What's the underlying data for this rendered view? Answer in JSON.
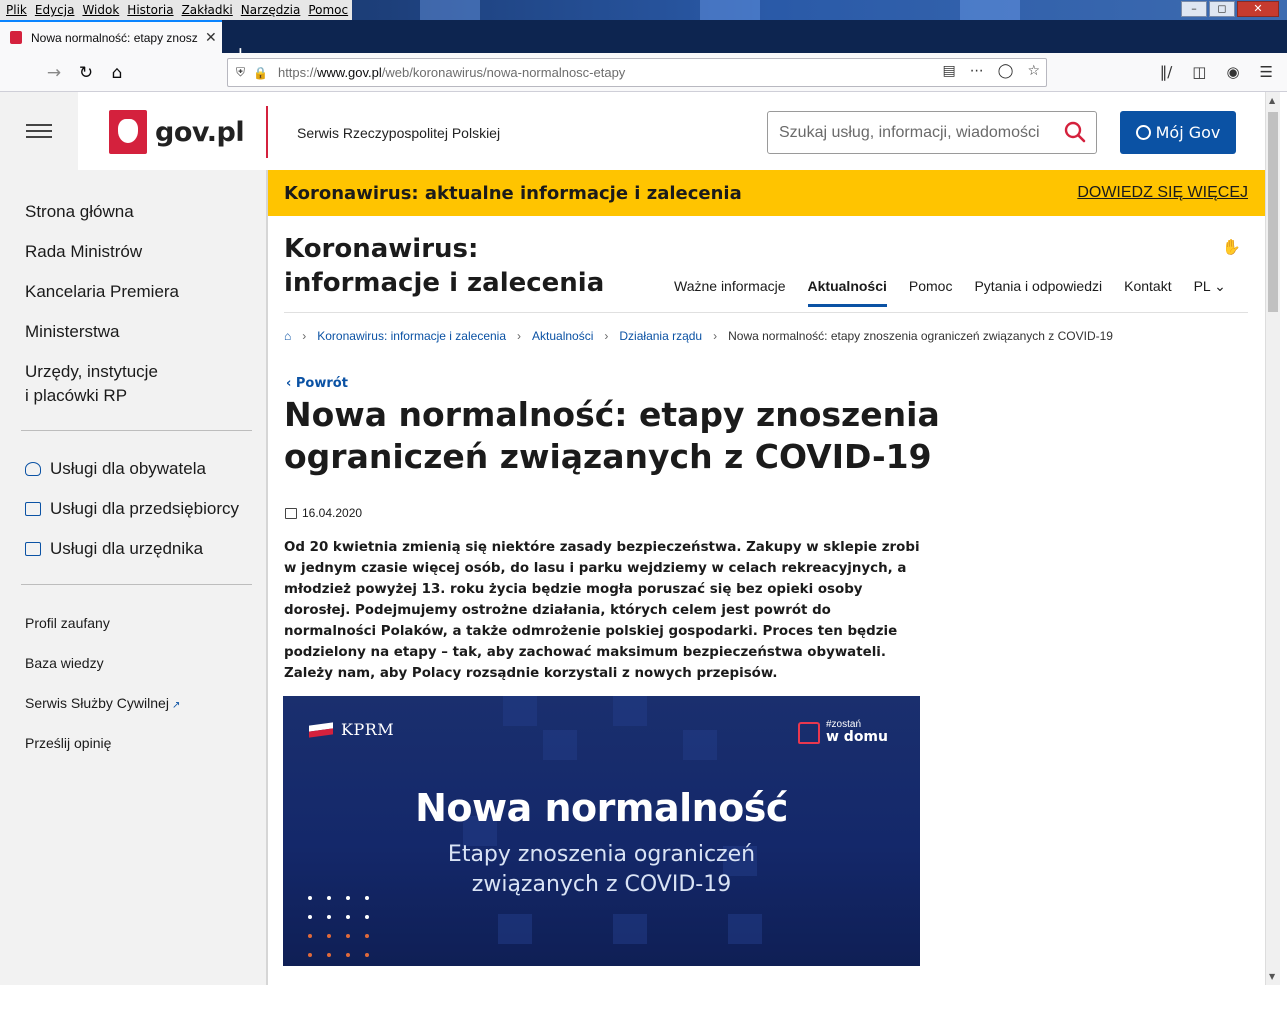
{
  "browser": {
    "menu": [
      "Plik",
      "Edycja",
      "Widok",
      "Historia",
      "Zakładki",
      "Narzędzia",
      "Pomoc"
    ],
    "tab_title": "Nowa normalność: etapy znosz",
    "url_prefix": "https://",
    "url_host": "www.gov.pl",
    "url_path": "/web/koronawirus/nowa-normalnosc-etapy"
  },
  "header": {
    "logo_text": "gov.pl",
    "tagline": "Serwis Rzeczypospolitej Polskiej",
    "search_placeholder": "Szukaj usług, informacji, wiadomości",
    "account_button": "Mój Gov"
  },
  "sidebar": {
    "main_items": [
      "Strona główna",
      "Rada Ministrów",
      "Kancelaria Premiera",
      "Ministerstwa",
      "Urzędy, instytucje",
      "i placówki RP"
    ],
    "services": [
      "Usługi dla obywatela",
      "Usługi dla przedsiębiorcy",
      "Usługi dla urzędnika"
    ],
    "links": [
      "Profil zaufany",
      "Baza wiedzy",
      "Serwis Służby Cywilnej",
      "Prześlij opinię"
    ]
  },
  "banner": {
    "title": "Koronawirus: aktualne informacje i zalecenia",
    "more": "DOWIEDZ SIĘ WIĘCEJ"
  },
  "section": {
    "title_line1": "Koronawirus:",
    "title_line2": "informacje i zalecenia",
    "nav": [
      "Ważne informacje",
      "Aktualności",
      "Pomoc",
      "Pytania i odpowiedzi",
      "Kontakt",
      "PL"
    ],
    "active_nav": "Aktualności"
  },
  "breadcrumb": [
    "Koronawirus: informacje i zalecenia",
    "Aktualności",
    "Działania rządu",
    "Nowa normalność: etapy znoszenia ograniczeń związanych z COVID-19"
  ],
  "article": {
    "back": "Powrót",
    "title": "Nowa normalność: etapy znoszenia ograniczeń związanych z COVID-19",
    "date": "16.04.2020",
    "lead": "Od 20 kwietnia zmienią się niektóre zasady bezpieczeństwa. Zakupy w sklepie zrobi w jednym czasie więcej osób, do lasu i parku wejdziemy w celach rekreacyjnych, a młodzież powyżej 13. roku życia będzie mogła poruszać się bez opieki osoby dorosłej. Podejmujemy ostrożne działania, których celem jest powrót do normalności Polaków, a także odmrożenie polskiej gospodarki. Proces ten będzie podzielony na etapy – tak, aby zachować maksimum bezpieczeństwa obywateli. Zależy nam, aby Polacy rozsądnie korzystali z nowych przepisów."
  },
  "hero": {
    "brand": "KPRM",
    "hashtag_small": "#zostań",
    "hashtag_big": "w domu",
    "headline": "Nowa normalność",
    "sub_line1": "Etapy znoszenia ograniczeń",
    "sub_line2": "związanych z COVID-19"
  },
  "colors": {
    "gov_red": "#d4213d",
    "gov_blue": "#0b52a4",
    "banner_yellow": "#ffc400",
    "hero_navy": "#14286a"
  }
}
